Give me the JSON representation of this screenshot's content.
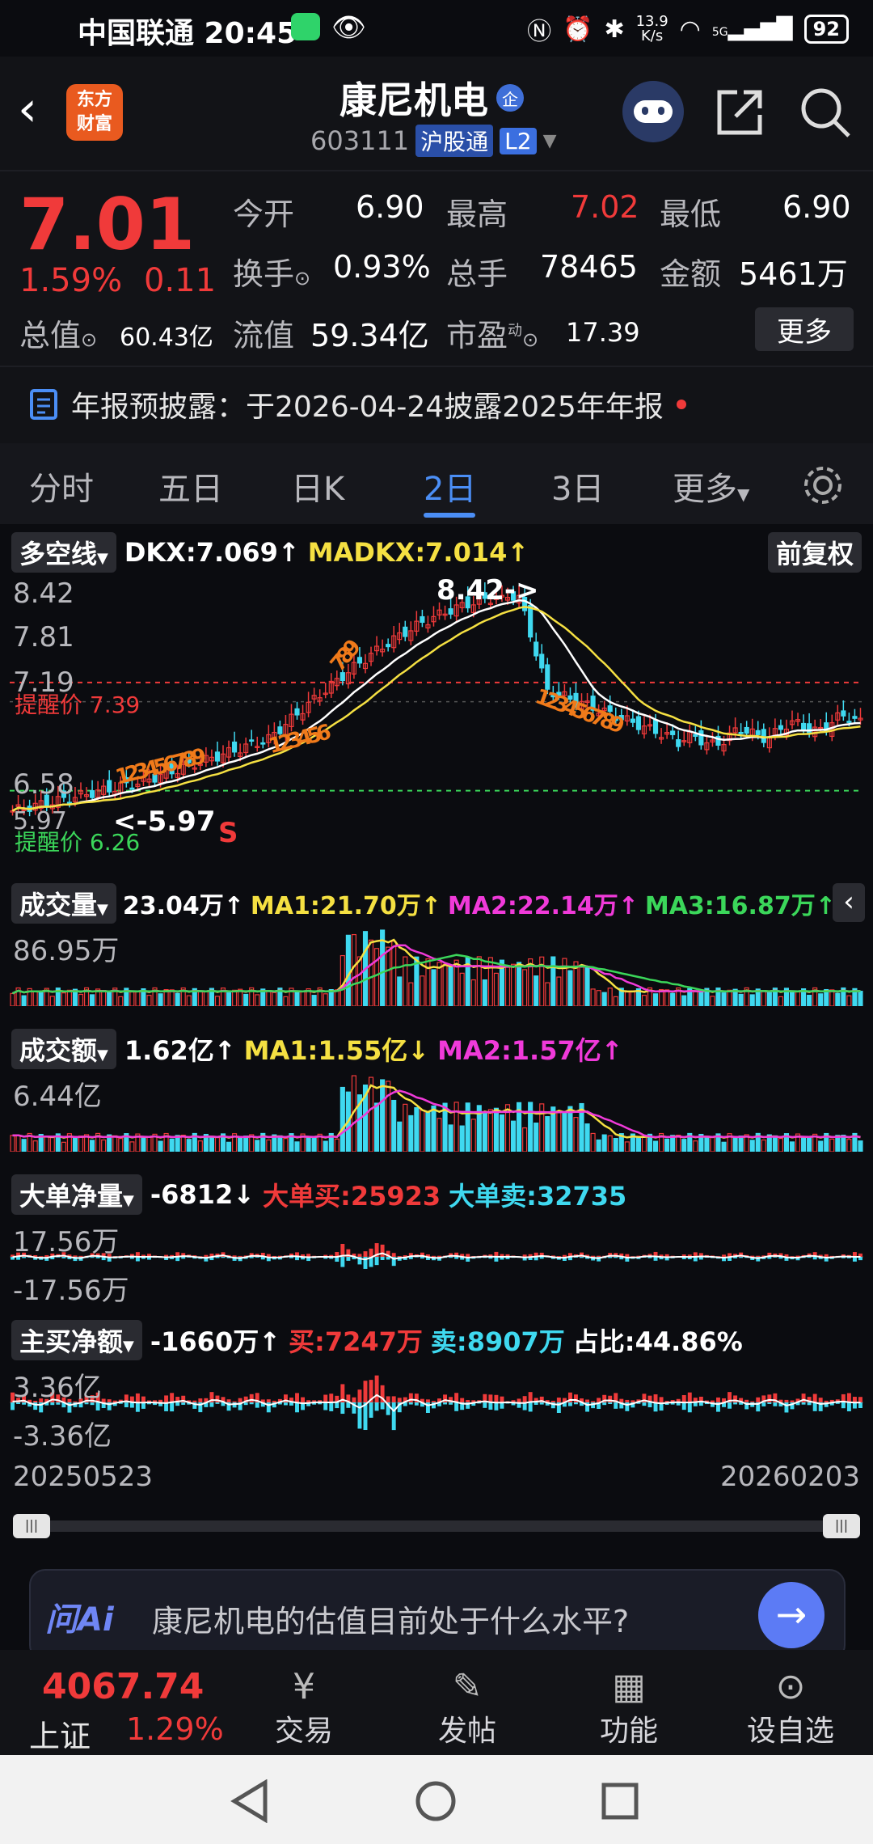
{
  "status": {
    "carrier_time": "中国联通 20:45",
    "net_speed": "13.9\nK/s",
    "signal": "5G",
    "battery": "92"
  },
  "header": {
    "logo_text": [
      "东方",
      "财富"
    ],
    "title": "康尼机电",
    "title_badge": "企",
    "code": "603111",
    "market": "沪股通",
    "level": "L2"
  },
  "quote": {
    "price": "7.01",
    "change_pct": "1.59%",
    "change_amt": "0.11",
    "open_label": "今开",
    "open": "6.90",
    "high_label": "最高",
    "high": "7.02",
    "low_label": "最低",
    "low": "6.90",
    "turnover_label": "换手",
    "turnover": "0.93%",
    "volume_label": "总手",
    "volume": "78465",
    "amount_label": "金额",
    "amount": "5461万",
    "mktcap_label": "总值",
    "mktcap": "60.43亿",
    "float_label": "流值",
    "float": "59.34亿",
    "pe_label": "市盈",
    "pe_sup": "动",
    "pe": "17.39",
    "more": "更多",
    "notice": "年报预披露：于2026-04-24披露2025年年报"
  },
  "tabs": [
    "分时",
    "五日",
    "日K",
    "2日",
    "3日",
    "更多"
  ],
  "tabs_active": "2日",
  "chart": {
    "indicator_main": "多空线",
    "dkx": "DKX:7.069↑",
    "madkx": "MADKX:7.014↑",
    "adjust": "前复权",
    "y_labels": [
      "8.42",
      "7.81",
      "7.19",
      "6.58",
      "5.97"
    ],
    "peak_label": "8.42->",
    "low_label": "<-5.97",
    "alert_high": "提醒价 7.39",
    "alert_low": "提醒价 6.26",
    "s_mark": "S",
    "vol_name": "成交量",
    "vol_val": "23.04万↑",
    "vol_ma1": "MA1:21.70万↑",
    "vol_ma2": "MA2:22.14万↑",
    "vol_ma3": "MA3:16.87万↑",
    "vol_y": "86.95万",
    "amt_name": "成交额",
    "amt_val": "1.62亿↑",
    "amt_ma1": "MA1:1.55亿↓",
    "amt_ma2": "MA2:1.57亿↑",
    "amt_y": "6.44亿",
    "big_name": "大单净量",
    "big_val": "-6812↓",
    "big_buy": "大单买:25923",
    "big_sell": "大单卖:32735",
    "big_y_top": "17.56万",
    "big_y_bot": "-17.56万",
    "main_name": "主买净额",
    "main_val": "-1660万↑",
    "main_buy": "买:7247万",
    "main_sell": "卖:8907万",
    "main_ratio": "占比:44.86%",
    "main_y_top": "3.36亿",
    "main_y_bot": "-3.36亿",
    "date_start": "20250523",
    "date_end": "20260203",
    "td_labels_left": "123456789",
    "td_labels_mid": "123456",
    "td_labels_top": "789",
    "td_labels_right": "123456789"
  },
  "ai": {
    "brand": "问Ai",
    "placeholder": "康尼机电的估值目前处于什么水平?"
  },
  "bottom": {
    "index_value": "4067.74",
    "index_name": "上证",
    "index_pct": "1.29%",
    "buttons": [
      "交易",
      "发帖",
      "功能",
      "设自选"
    ]
  },
  "colors": {
    "up": "#f03a3a",
    "down": "#3fd9f0",
    "accent": "#4b8ef5"
  }
}
